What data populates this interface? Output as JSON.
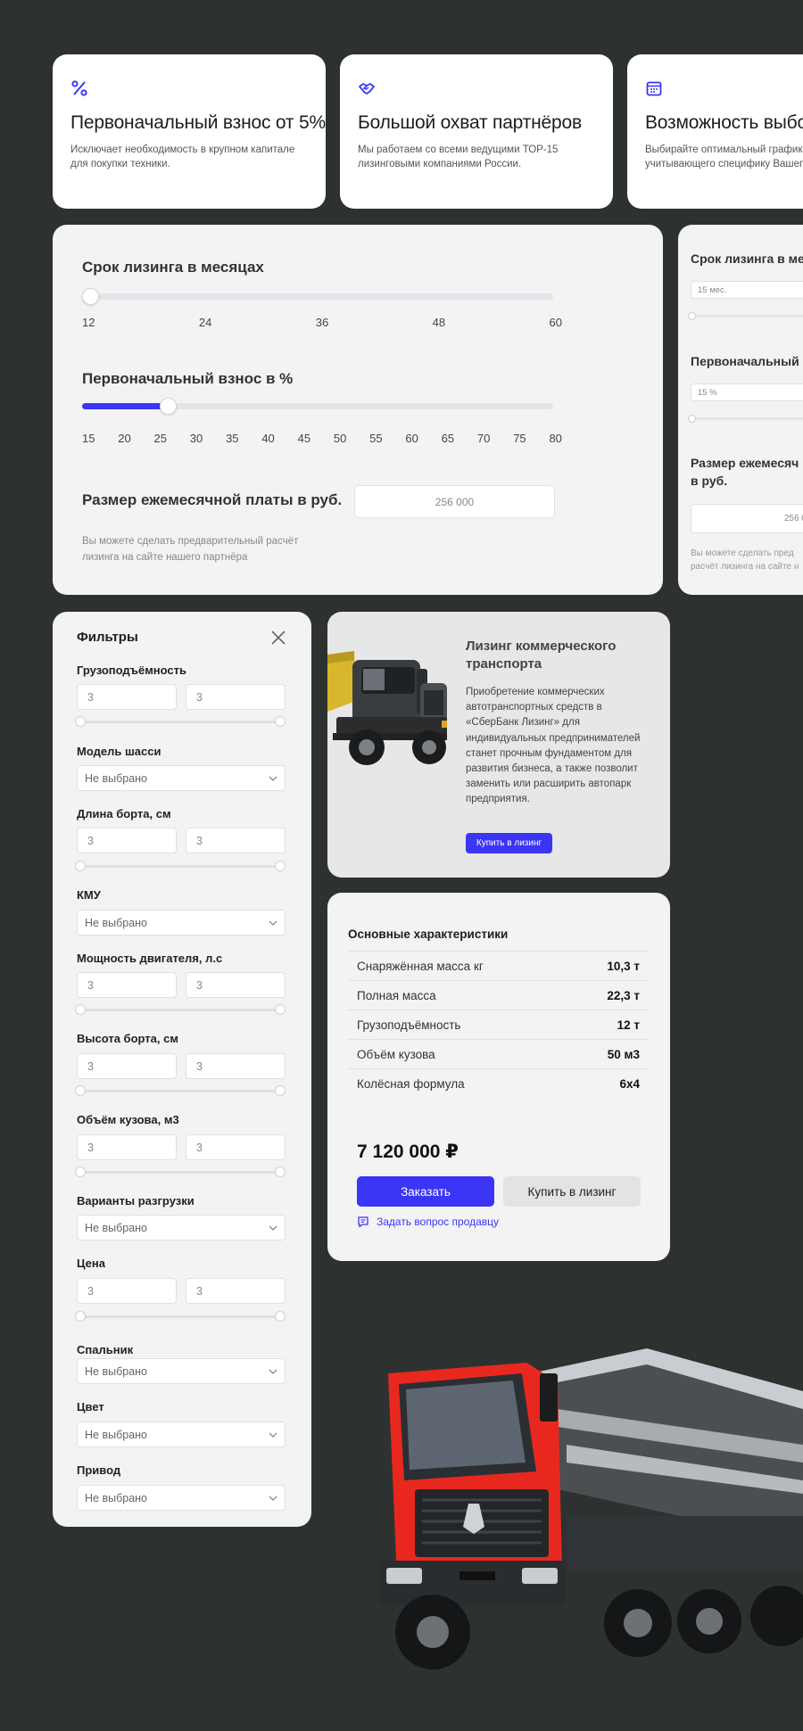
{
  "features": [
    {
      "icon": "percent-icon",
      "title": "Первоначальный взнос от 5%",
      "desc1": "Исключает необходимость в крупном капитале",
      "desc2": "для покупки техники."
    },
    {
      "icon": "handshake-icon",
      "title": "Большой охват партнёров",
      "desc1": "Мы работаем со всеми ведущими ТОР-15",
      "desc2": "лизинговыми компаниями России."
    },
    {
      "icon": "calendar-icon",
      "title": "Возможность выбора",
      "desc1": "Выбирайте оптимальный график п",
      "desc2": "учитывающего специфику Вашего"
    }
  ],
  "calculator": {
    "term_label": "Срок лизинга в месяцах",
    "term_ticks": [
      "12",
      "24",
      "36",
      "48",
      "60"
    ],
    "term_value_fraction": 0,
    "down_label": "Первоначальный взнос в %",
    "down_ticks": [
      "15",
      "20",
      "25",
      "30",
      "35",
      "40",
      "45",
      "50",
      "55",
      "60",
      "65",
      "70",
      "75",
      "80"
    ],
    "down_value_fraction": 0.165,
    "payment_label": "Размер ежемесячной платы в руб.",
    "payment_value": "256 000",
    "note": "Вы можете сделать предварительный расчёт лизинга на сайте нашего партнёра"
  },
  "calculator_compact": {
    "term_label": "Срок лизинга в ме",
    "term_value": "15 мес.",
    "down_label": "Первоначальный",
    "down_value": "15 %",
    "payment_label_1": "Размер ежемесяч",
    "payment_label_2": "в руб.",
    "payment_value": "256 000",
    "note_1": "Вы можете сделать пред",
    "note_2": "расчёт лизинга на сайте н"
  },
  "filters": {
    "title": "Фильтры",
    "load_capacity": {
      "label": "Грузоподъёмность",
      "from": "3",
      "to": "3"
    },
    "chassis_model": {
      "label": "Модель шасси",
      "value": "Не выбрано"
    },
    "side_length": {
      "label": "Длина борта, см",
      "from": "3",
      "to": "3"
    },
    "kmu": {
      "label": "КМУ",
      "value": "Не выбрано"
    },
    "engine_power": {
      "label": "Мощность двигателя, л.с",
      "from": "3",
      "to": "3"
    },
    "side_height": {
      "label": "Высота борта, см",
      "from": "3",
      "to": "3"
    },
    "body_volume": {
      "label": "Объём кузова, м3",
      "from": "3",
      "to": "3"
    },
    "unloading": {
      "label": "Варианты разгрузки",
      "value": "Не выбрано"
    },
    "price": {
      "label": "Цена",
      "from": "3",
      "to": "3"
    },
    "sleeper": {
      "label": "Спальник",
      "value": "Не выбрано"
    },
    "color": {
      "label": "Цвет",
      "value": "Не выбрано"
    },
    "drive": {
      "label": "Привод",
      "value": "Не выбрано"
    }
  },
  "promo": {
    "title": "Лизинг коммерческого транспорта",
    "text": "Приобретение коммерческих автотранспортных средств в «СберБанк Лизинг» для индивидуальных предпринимателей станет прочным фундаментом для развития бизнеса, а также позволит заменить или расширить автопарк предприятия.",
    "button": "Купить в лизинг"
  },
  "specs": {
    "title": "Основные характеристики",
    "rows": [
      {
        "name": "Снаряжённая масса кг",
        "value": "10,3 т"
      },
      {
        "name": "Полная масса",
        "value": "22,3 т"
      },
      {
        "name": "Грузоподъёмность",
        "value": "12 т"
      },
      {
        "name": "Объём кузова",
        "value": "50 м3"
      },
      {
        "name": "Колёсная формула",
        "value": "6х4"
      }
    ],
    "price": "7 120 000 ₽",
    "order_button": "Заказать",
    "lease_button": "Купить в лизинг",
    "ask_link": "Задать вопрос продавцу"
  },
  "colors": {
    "accent": "#3b35f5",
    "background": "#2d3230",
    "truck_red": "#e8281f"
  }
}
